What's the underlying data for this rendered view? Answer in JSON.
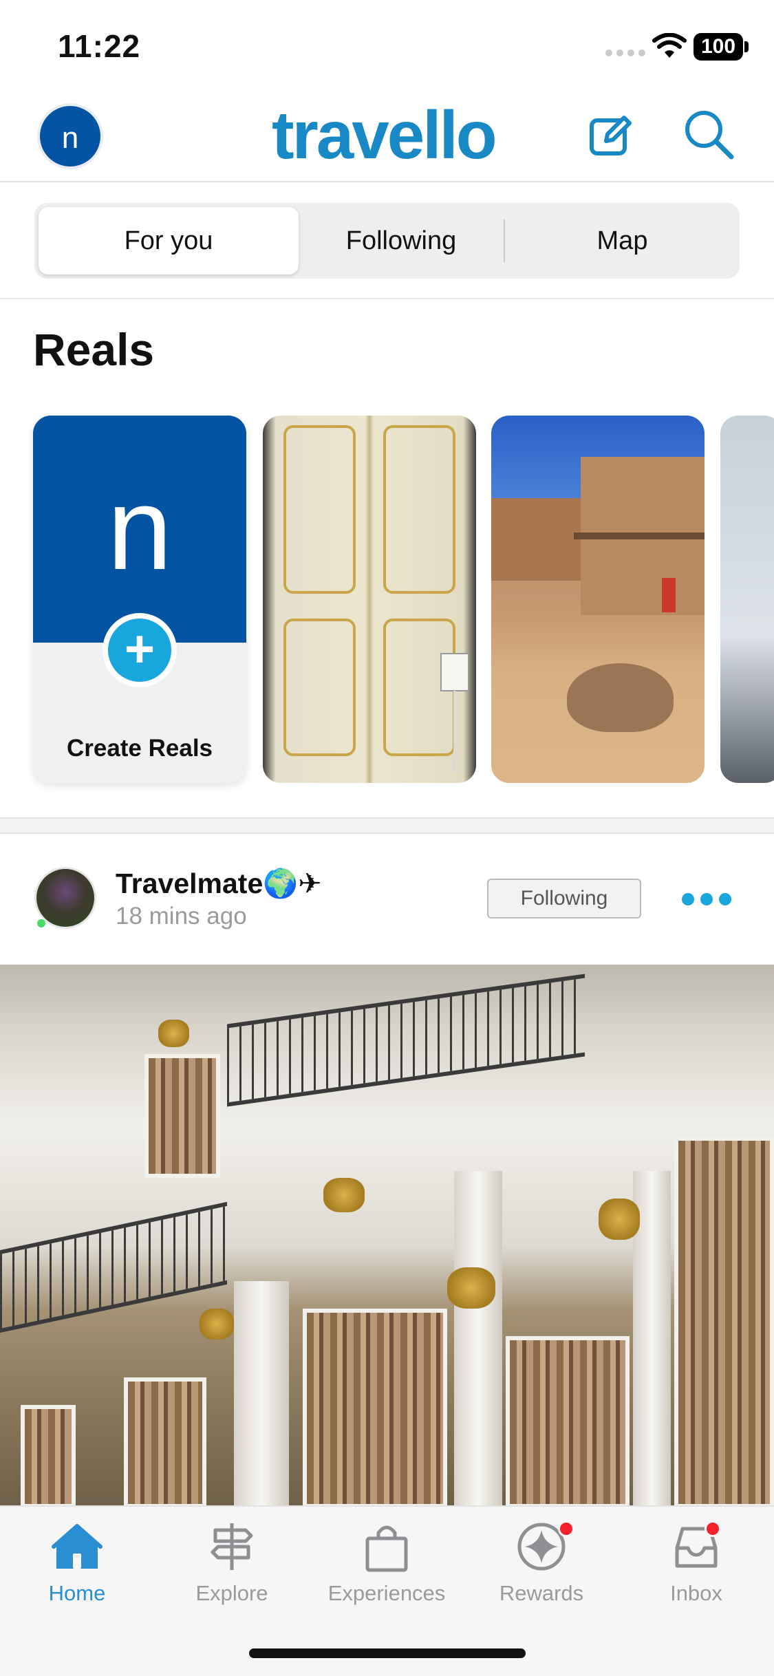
{
  "status_bar": {
    "time": "11:22",
    "battery": "100"
  },
  "header": {
    "avatar_initial": "n",
    "brand": "travello"
  },
  "tabs": [
    {
      "label": "For you",
      "active": true
    },
    {
      "label": "Following",
      "active": false
    },
    {
      "label": "Map",
      "active": false
    }
  ],
  "reels": {
    "title": "Reals",
    "create_initial": "n",
    "create_plus": "+",
    "create_label": "Create Reals"
  },
  "post": {
    "author": "Travelmate🌍✈",
    "time": "18 mins ago",
    "follow_label": "Following"
  },
  "bottom_nav": [
    {
      "label": "Home",
      "icon": "home-icon",
      "active": true,
      "badge": false
    },
    {
      "label": "Explore",
      "icon": "signpost-icon",
      "active": false,
      "badge": false
    },
    {
      "label": "Experiences",
      "icon": "bag-icon",
      "active": false,
      "badge": false
    },
    {
      "label": "Rewards",
      "icon": "rewards-star-icon",
      "active": false,
      "badge": true
    },
    {
      "label": "Inbox",
      "icon": "inbox-icon",
      "active": false,
      "badge": true
    }
  ],
  "colors": {
    "brand_blue": "#1989c6",
    "dark_blue": "#0554a3",
    "accent_cyan": "#19a6dd",
    "badge_red": "#f5212b"
  }
}
